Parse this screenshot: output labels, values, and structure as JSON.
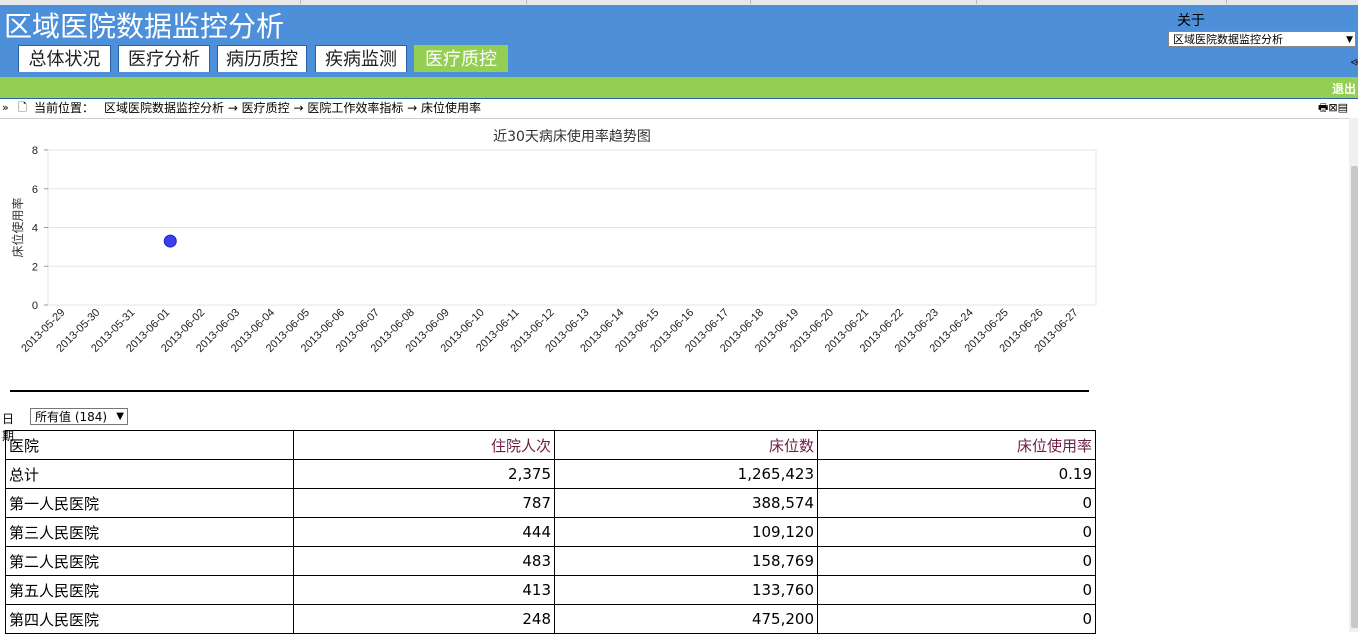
{
  "app": {
    "title": "区域医院数据监控分析",
    "about": "关于",
    "system_select": "区域医院数据监控分析",
    "logout": "退出"
  },
  "tabs": [
    {
      "label": "总体状况",
      "active": false
    },
    {
      "label": "医疗分析",
      "active": false
    },
    {
      "label": "病历质控",
      "active": false
    },
    {
      "label": "疾病监测",
      "active": false
    },
    {
      "label": "医疗质控",
      "active": true
    }
  ],
  "breadcrumb": {
    "label": "当前位置：",
    "path": "区域医院数据监控分析 → 医疗质控 → 医院工作效率指标 → 床位使用率"
  },
  "colors": {
    "header_blue": "#4d90d9",
    "active_green": "#92cf53",
    "point_blue": "#3b3ff0",
    "header_text_maroon": "#6e1e45"
  },
  "chart_data": {
    "type": "scatter",
    "title": "近30天病床使用率趋势图",
    "ylabel": "床位使用率",
    "ylim": [
      0,
      8
    ],
    "yticks": [
      0,
      2,
      4,
      6,
      8
    ],
    "grid": true,
    "categories": [
      "2013-05-29",
      "2013-05-30",
      "2013-05-31",
      "2013-06-01",
      "2013-06-02",
      "2013-06-03",
      "2013-06-04",
      "2013-06-05",
      "2013-06-06",
      "2013-06-07",
      "2013-06-08",
      "2013-06-09",
      "2013-06-10",
      "2013-06-11",
      "2013-06-12",
      "2013-06-13",
      "2013-06-14",
      "2013-06-15",
      "2013-06-16",
      "2013-06-17",
      "2013-06-18",
      "2013-06-19",
      "2013-06-20",
      "2013-06-21",
      "2013-06-22",
      "2013-06-23",
      "2013-06-24",
      "2013-06-25",
      "2013-06-26",
      "2013-06-27"
    ],
    "points": [
      {
        "x": "2013-06-01",
        "y": 3.3
      }
    ]
  },
  "filter": {
    "label": "日期",
    "value": "所有值 (184)"
  },
  "table": {
    "headers": [
      "医院",
      "住院人次",
      "床位数",
      "床位使用率"
    ],
    "rows": [
      [
        "总计",
        "2,375",
        "1,265,423",
        "0.19"
      ],
      [
        "第一人民医院",
        "787",
        "388,574",
        "0"
      ],
      [
        "第三人民医院",
        "444",
        "109,120",
        "0"
      ],
      [
        "第二人民医院",
        "483",
        "158,769",
        "0"
      ],
      [
        "第五人民医院",
        "413",
        "133,760",
        "0"
      ],
      [
        "第四人民医院",
        "248",
        "475,200",
        "0"
      ]
    ]
  }
}
